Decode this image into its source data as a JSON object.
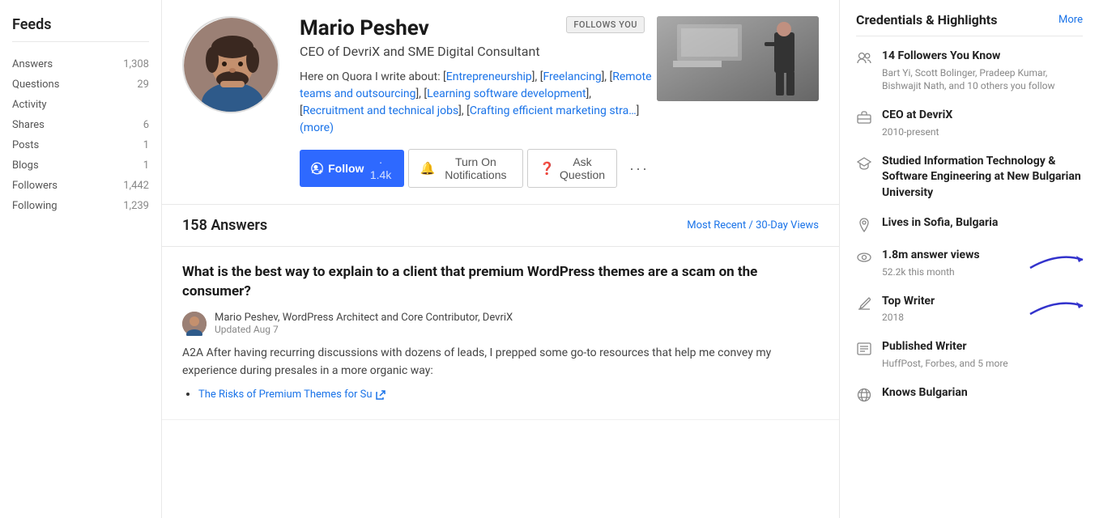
{
  "sidebar": {
    "feeds_title": "Feeds",
    "items": [
      {
        "label": "Answers",
        "count": "1,308"
      },
      {
        "label": "Questions",
        "count": "29"
      },
      {
        "label": "Activity",
        "count": ""
      },
      {
        "label": "Shares",
        "count": "6"
      },
      {
        "label": "Posts",
        "count": "1"
      },
      {
        "label": "Blogs",
        "count": "1"
      },
      {
        "label": "Followers",
        "count": "1,442"
      },
      {
        "label": "Following",
        "count": "1,239"
      }
    ]
  },
  "profile": {
    "name": "Mario Peshev",
    "title": "CEO of DevriX and SME Digital Consultant",
    "bio_text": "Here on Quora I write about: [Entrepreneurship], [Freelancing], [Remote teams and outsourcing], [Learning software development], [Recruitment and technical jobs], [Crafting efficient marketing stra…",
    "bio_more": "(more)",
    "follows_you": "FOLLOWS YOU",
    "follow_button": "Follow",
    "follow_count": "· 1.4k",
    "turn_on_notifications": "Turn On Notifications",
    "ask_question": "Ask Question",
    "more_button": "···"
  },
  "answers": {
    "count": "158 Answers",
    "sort_label": "Most Recent",
    "sort_separator": "/",
    "sort_views": "30-Day Views",
    "question": "What is the best way to explain to a client that premium WordPress themes are a scam on the consumer?",
    "author": "Mario Peshev, WordPress Architect and Core Contributor, DevriX",
    "updated": "Updated Aug 7",
    "body1": "A2A After having recurring discussions with dozens of leads, I prepped some go-to resources that help me convey my experience during presales in a more organic way:",
    "link_text": "The Risks of Premium Themes for Su",
    "link_suffix": "..."
  },
  "credentials": {
    "title": "Credentials & Highlights",
    "more": "More",
    "items": [
      {
        "icon": "people",
        "text": "14 Followers You Know",
        "sub": "Bart Yi, Scott Bolinger, Pradeep Kumar, Bishwajit Nath, and 10 others you follow"
      },
      {
        "icon": "work",
        "text": "CEO at DevriX",
        "sub": "2010-present"
      },
      {
        "icon": "education",
        "text": "Studied Information Technology & Software Engineering at New Bulgarian University",
        "sub": ""
      },
      {
        "icon": "location",
        "text": "Lives in Sofia, Bulgaria",
        "sub": ""
      },
      {
        "icon": "views",
        "text": "1.8m answer views",
        "sub": "52.2k this month"
      },
      {
        "icon": "writer",
        "text": "Top Writer",
        "sub": "2018"
      },
      {
        "icon": "published",
        "text": "Published Writer",
        "sub": "HuffPost, Forbes, and 5 more"
      },
      {
        "icon": "language",
        "text": "Knows Bulgarian",
        "sub": ""
      }
    ]
  }
}
